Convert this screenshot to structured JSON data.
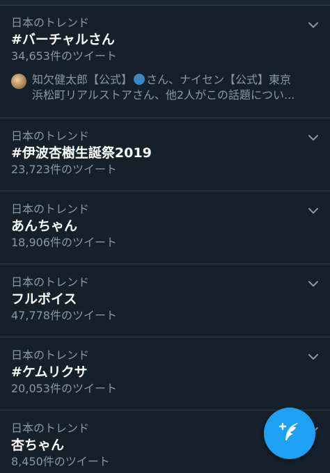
{
  "trends": [
    {
      "context": "日本のトレンド",
      "name": "#バーチャルさん",
      "count": "34,653件のツイート",
      "description": {
        "line1_before_icon": "知欠健太郎【公式】",
        "line1_after_icon": "さん、ナイセン【公式】東京",
        "line2": "浜松町リアルストアさん、他2人がこの話題につい..."
      }
    },
    {
      "context": "日本のトレンド",
      "name": "#伊波杏樹生誕祭2019",
      "count": "23,723件のツイート"
    },
    {
      "context": "日本のトレンド",
      "name": "あんちゃん",
      "count": "18,906件のツイート"
    },
    {
      "context": "日本のトレンド",
      "name": "フルボイス",
      "count": "47,778件のツイート"
    },
    {
      "context": "日本のトレンド",
      "name": "#ケムリクサ",
      "count": "20,053件のツイート"
    },
    {
      "context": "日本のトレンド",
      "name": "杏ちゃん",
      "count": "8,450件のツイート"
    }
  ],
  "icons": {
    "chevron": "chevron-down-icon",
    "compose": "compose-tweet-icon",
    "avatar": "user-avatar"
  },
  "colors": {
    "background": "#15202b",
    "divider": "#38444d",
    "secondary_text": "#8899a6",
    "primary_text": "#ffffff",
    "accent": "#1da1f2"
  }
}
